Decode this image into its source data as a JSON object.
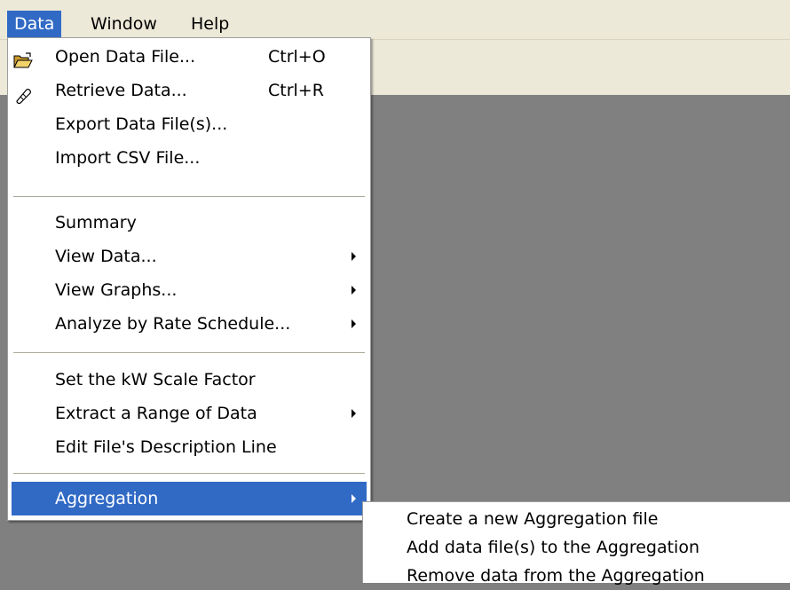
{
  "menubar": {
    "items": [
      {
        "label": "Data"
      },
      {
        "label": "Window"
      },
      {
        "label": "Help"
      }
    ]
  },
  "data_menu": {
    "items": [
      {
        "label": "Open Data File...",
        "shortcut": "Ctrl+O",
        "icon": "folder-open-icon"
      },
      {
        "label": "Retrieve Data...",
        "shortcut": "Ctrl+R",
        "icon": "retrieve-probe-icon"
      },
      {
        "label": "Export Data File(s)..."
      },
      {
        "label": "Import CSV File..."
      },
      {
        "label": "Summary"
      },
      {
        "label": "View Data...",
        "has_submenu": true
      },
      {
        "label": "View Graphs...",
        "has_submenu": true
      },
      {
        "label": "Analyze by Rate Schedule...",
        "has_submenu": true
      },
      {
        "label": "Set the kW Scale Factor"
      },
      {
        "label": "Extract a Range of Data",
        "has_submenu": true
      },
      {
        "label": "Edit File's Description Line"
      },
      {
        "label": "Aggregation",
        "has_submenu": true,
        "highlighted": true
      }
    ]
  },
  "aggregation_submenu": {
    "items": [
      {
        "label": "Create a new Aggregation file"
      },
      {
        "label": "Add data file(s) to the Aggregation"
      },
      {
        "label": "Remove data from the Aggregation"
      }
    ]
  },
  "colors": {
    "highlight": "#316ac5",
    "menubar_bg": "#ece9d8",
    "workspace_bg": "#808080"
  }
}
